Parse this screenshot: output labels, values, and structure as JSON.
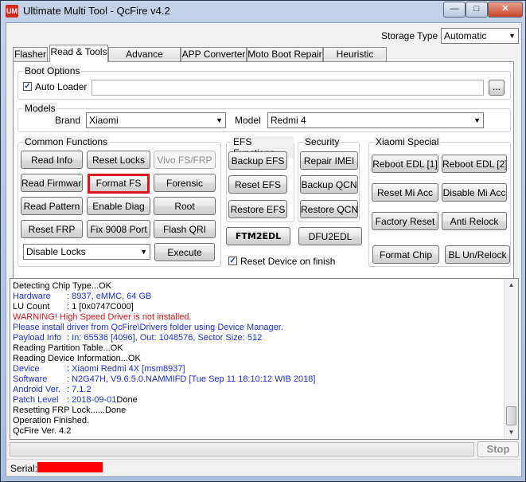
{
  "window": {
    "title": "Ultimate Multi Tool - QcFire v4.2",
    "app_icon": "UM",
    "minimize": "—",
    "maximize": "□",
    "close": "✕"
  },
  "storage": {
    "label": "Storage Type",
    "value": "Automatic"
  },
  "tabs": [
    "Flasher",
    "Read & Tools",
    "Advance Flasher",
    "APP Converter",
    "Moto Boot Repair",
    "Heuristic Mode"
  ],
  "boot_options": {
    "title": "Boot Options",
    "auto_loader": "Auto Loader",
    "auto_loader_checked": true,
    "browse": "..."
  },
  "models": {
    "title": "Models",
    "brand_label": "Brand",
    "brand_value": "Xiaomi",
    "model_label": "Model",
    "model_value": "Redmi 4"
  },
  "common": {
    "title": "Common Functions",
    "read_info": "Read Info",
    "reset_locks": "Reset Locks",
    "vivo_fs_frp": "Vivo FS/FRP",
    "read_firmware": "Read Firmware",
    "format_fs": "Format FS",
    "forensic": "Forensic",
    "read_pattern": "Read Pattern",
    "enable_diag": "Enable Diag",
    "root": "Root",
    "reset_frp": "Reset FRP",
    "fix_9008": "Fix 9008 Port",
    "flash_qri": "Flash QRI",
    "locks_select": "Disable Locks",
    "execute": "Execute"
  },
  "efs": {
    "title": "EFS Functions",
    "backup": "Backup EFS",
    "reset": "Reset EFS",
    "restore": "Restore EFS",
    "ftm2edl": "FTM2EDL"
  },
  "security": {
    "title": "Security",
    "repair_imei": "Repair IMEI",
    "backup_qcn": "Backup QCN",
    "restore_qcn": "Restore QCN",
    "dfu2edl": "DFU2EDL"
  },
  "reset_on_finish": {
    "label": "Reset Device on finish",
    "checked": true
  },
  "xiaomi": {
    "title": "Xiaomi Special",
    "reboot_edl1": "Reboot EDL [1]",
    "reboot_edl2": "Reboot EDL [2]",
    "reset_mi": "Reset Mi Acc",
    "disable_mi": "Disable Mi Acc",
    "factory_reset": "Factory Reset",
    "anti_relock": "Anti Relock",
    "format_chip": "Format Chip",
    "bl_unrelock": "BL Un/Relock"
  },
  "log": [
    {
      "key": "Detecting Chip Type...OK",
      "value": "",
      "color": "#000000"
    },
    {
      "key": "Hardware",
      "value": ": 8937, eMMC, 64 GB",
      "color": "#1c2fd6"
    },
    {
      "key": "LU Count",
      "value": ": 1 [0x0747C000]",
      "color": "#000000"
    },
    {
      "key": "WARNING! High Speed Driver is not installed.",
      "value": "",
      "color": "#e0141b"
    },
    {
      "key": "Please install driver from QcFire\\Drivers folder using Device Manager.",
      "value": "",
      "color": "#1c2fd6"
    },
    {
      "key": "Payload Info",
      "value": ": In: 65536 [4096], Out: 1048576, Sector Size: 512",
      "color": "#1c2fd6"
    },
    {
      "key": "Reading Partition Table...OK",
      "value": "",
      "color": "#000000"
    },
    {
      "key": "Reading Device Information...OK",
      "value": "",
      "color": "#000000"
    },
    {
      "key": "Device",
      "value": ": Xiaomi Redmi 4X [msm8937]",
      "color": "#1c2fd6"
    },
    {
      "key": "Software",
      "value": ": N2G47H, V9.6.5.0.NAMMIFD [Tue Sep 11 18:10:12 WIB 2018]",
      "color": "#1c2fd6"
    },
    {
      "key": "Android Ver.",
      "value": ": 7.1.2",
      "color": "#1c2fd6"
    },
    {
      "key": "Patch Level",
      "value": ": 2018-09-01",
      "suffix": "Done",
      "color": "#1c2fd6"
    },
    {
      "key": "Resetting FRP Lock......Done",
      "value": "",
      "color": "#000000"
    },
    {
      "key": "Operation Finished.",
      "value": "",
      "color": "#000000"
    },
    {
      "key": "QcFire Ver. 4.2",
      "value": "",
      "color": "#000000"
    }
  ],
  "stop": "Stop",
  "serial_label": "Serial:",
  "colors": {
    "highlight": "#e0141b",
    "serial_redaction": "#ff0000",
    "log_blue": "#1c2fd6"
  }
}
